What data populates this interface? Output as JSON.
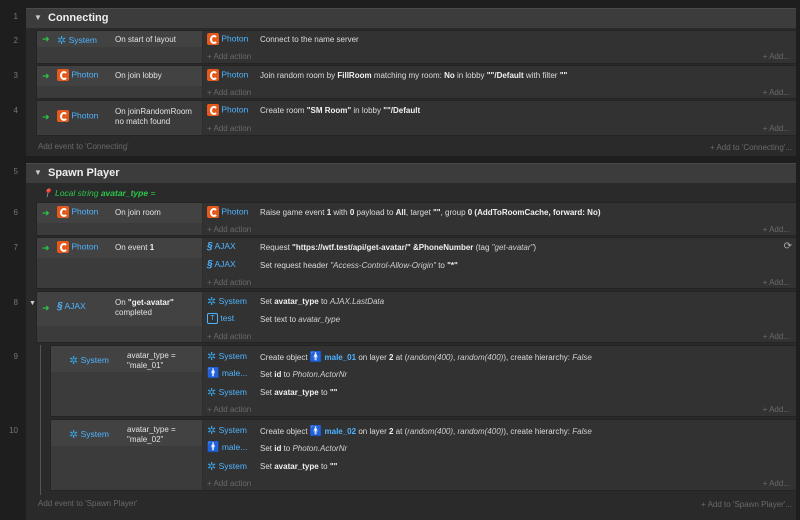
{
  "add_action": "+ Add action",
  "add_ellipsis": "+ Add...",
  "groups": [
    {
      "name": "Connecting",
      "line": "1",
      "add_event": "Add event to 'Connecting'",
      "add_event_right": "+ Add to 'Connecting'..."
    },
    {
      "name": "Spawn Player",
      "line": "5",
      "add_event": "Add event to 'Spawn Player'",
      "add_event_right": "+ Add to 'Spawn Player'..."
    }
  ],
  "local_var": {
    "prefix": "Local string",
    "name": "avatar_type",
    "suffix": "="
  },
  "events": [
    {
      "line": "2",
      "obj": "System",
      "cond": "On start of layout",
      "actions": [
        {
          "obj": "Photon",
          "text": "Connect to the name server"
        }
      ]
    },
    {
      "line": "3",
      "obj": "Photon",
      "cond": "On join lobby",
      "actions": [
        {
          "obj": "Photon",
          "t1": "Join random room by ",
          "b1": "FillRoom",
          "t2": " matching my room: ",
          "b2": "No",
          "t3": " in lobby ",
          "b3": "\"\"/Default",
          "t4": " with filter ",
          "b4": "\"\""
        }
      ]
    },
    {
      "line": "4",
      "obj": "Photon",
      "cond1": "On joinRandomRoom",
      "cond2": "no match found",
      "actions": [
        {
          "obj": "Photon",
          "t1": "Create room ",
          "b1": "\"SM Room\"",
          "t2": " in lobby ",
          "b2": "\"\"/Default"
        }
      ]
    },
    {
      "line": "6",
      "obj": "Photon",
      "cond": "On join room",
      "actions": [
        {
          "obj": "Photon",
          "t1": "Raise game event ",
          "b1": "1",
          "t2": " with ",
          "b2": "0",
          "t3": " payload to ",
          "b3": "All",
          "t4": ", target ",
          "b4": "\"\"",
          "t5": ", group ",
          "b5": "0 (AddToRoomCache, forward: No)"
        }
      ]
    },
    {
      "line": "7",
      "obj": "Photon",
      "cond_pre": "On event ",
      "cond_b": "1",
      "actions": [
        {
          "obj": "AJAX",
          "t1": "Request ",
          "b1": "\"https://wtf.test/api/get-avatar/\" &PhoneNumber",
          "t2": " (tag ",
          "i1": "\"get-avatar\"",
          "t3": ")"
        },
        {
          "obj": "AJAX",
          "t1": "Set request header ",
          "i1": "\"Access-Control-Allow-Origin\"",
          "t2": " to ",
          "b1": "\"*\""
        }
      ]
    },
    {
      "line": "8",
      "obj": "AJAX",
      "cond_pre": "On ",
      "cond_b": "\"get-avatar\"",
      "cond2": "completed",
      "actions": [
        {
          "obj": "System",
          "t1": "Set ",
          "b1": "avatar_type",
          "t2": " to ",
          "i1": "AJAX.LastData"
        },
        {
          "obj": "test",
          "t1": "Set text to ",
          "i1": "avatar_type"
        }
      ]
    },
    {
      "line": "9",
      "obj": "System",
      "cond1": "avatar_type =",
      "cond2": "\"male_01\"",
      "actions": [
        {
          "obj": "System",
          "t1": "Create object ",
          "b1": "male_01",
          "t2": " on layer ",
          "b2": "2",
          "t3": " at (",
          "i1": "random(400)",
          "t4": ", ",
          "i2": "random(400)",
          "t5": "), create hierarchy: ",
          "i3": "False"
        },
        {
          "obj": "male...",
          "t1": "Set ",
          "b1": "id",
          "t2": " to ",
          "i1": "Photon.ActorNr"
        },
        {
          "obj": "System",
          "t1": "Set ",
          "b1": "avatar_type",
          "t2": " to ",
          "b2": "\"\""
        }
      ]
    },
    {
      "line": "10",
      "obj": "System",
      "cond1": "avatar_type =",
      "cond2": "\"male_02\"",
      "actions": [
        {
          "obj": "System",
          "t1": "Create object ",
          "b1": "male_02",
          "t2": " on layer ",
          "b2": "2",
          "t3": " at (",
          "i1": "random(400)",
          "t4": ", ",
          "i2": "random(400)",
          "t5": "), create hierarchy: ",
          "i3": "False"
        },
        {
          "obj": "male...",
          "t1": "Set ",
          "b1": "id",
          "t2": " to ",
          "i1": "Photon.ActorNr"
        },
        {
          "obj": "System",
          "t1": "Set ",
          "b1": "avatar_type",
          "t2": " to ",
          "b2": "\"\""
        }
      ]
    }
  ]
}
